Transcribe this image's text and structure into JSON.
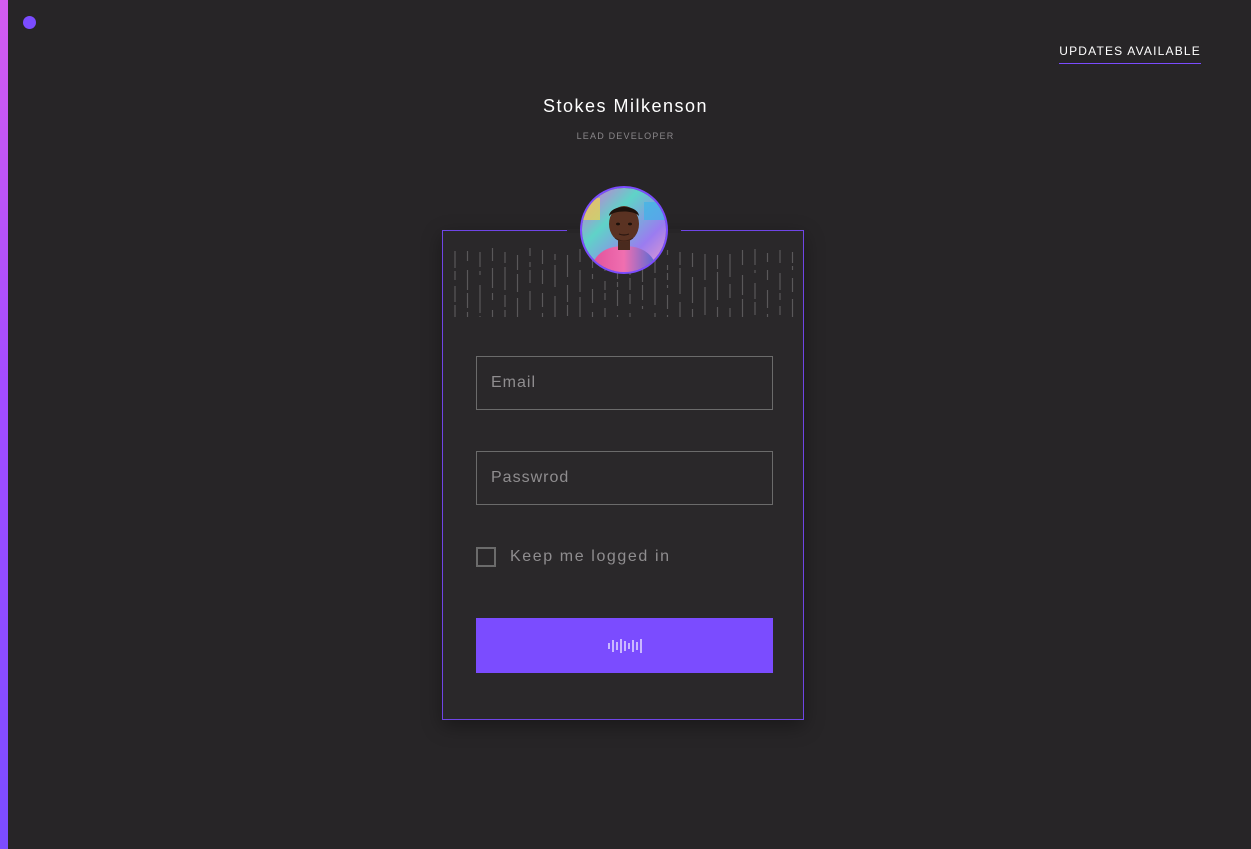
{
  "header": {
    "updates_label": "UPDATES AVAILABLE"
  },
  "profile": {
    "name": "Stokes Milkenson",
    "role": "LEAD DEVELOPER"
  },
  "form": {
    "email_placeholder": "Email",
    "password_placeholder": "Passwrod",
    "remember_label": "Keep me logged in",
    "remember_checked": false,
    "submit_icon": "loading-bars-icon"
  },
  "colors": {
    "accent": "#7b4cff",
    "background": "#272527",
    "card_border": "#6f45e6",
    "side_gradient_top": "#d45cf0",
    "side_gradient_bottom": "#7b4cff"
  }
}
